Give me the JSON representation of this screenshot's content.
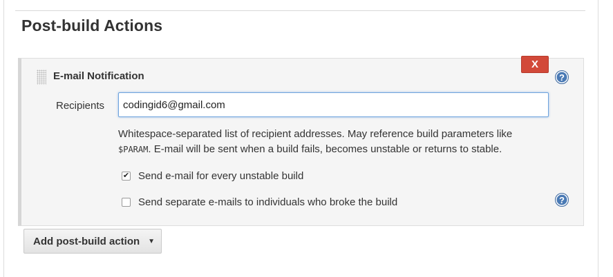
{
  "section": {
    "title": "Post-build Actions"
  },
  "step": {
    "name": "E-mail Notification",
    "delete_label": "X",
    "help_glyph": "?",
    "recipients": {
      "label": "Recipients",
      "value": "codingid6@gmail.com"
    },
    "help_text": {
      "part1": "Whitespace-separated list of recipient addresses. May reference build parameters like",
      "code": "$PARAM",
      "part2": ". E-mail will be sent when a build fails, becomes unstable or returns to stable."
    },
    "options": [
      {
        "label": "Send e-mail for every unstable build",
        "checked": true,
        "glyph": "✔"
      },
      {
        "label": "Send separate e-mails to individuals who broke the build",
        "checked": false,
        "glyph": ""
      }
    ]
  },
  "add_action": {
    "label": "Add post-build action",
    "caret": "▼"
  },
  "colors": {
    "delete_button": "#d24939",
    "help_icon": "#4a7ab5",
    "input_focus_border": "#6ea3dd"
  },
  "icons": [
    "drag-handle-icon",
    "help-icon",
    "chevron-down-icon",
    "checkmark-icon"
  ]
}
